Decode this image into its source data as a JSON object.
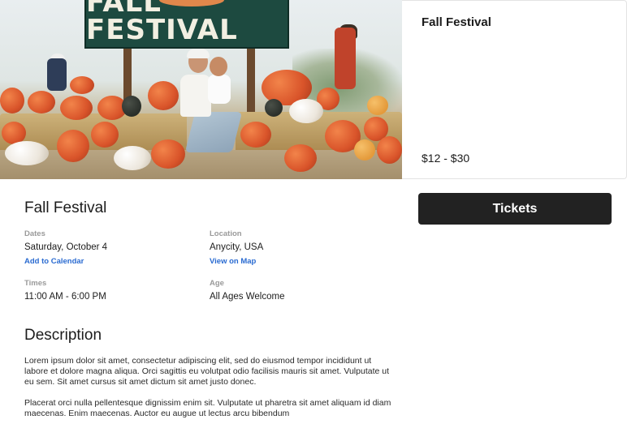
{
  "hero": {
    "sign_text": "FALL FESTIVAL"
  },
  "card": {
    "title": "Fall Festival",
    "price": "$12 - $30"
  },
  "event": {
    "title": "Fall Festival",
    "dates_label": "Dates",
    "dates_value": "Saturday, October 4",
    "add_to_calendar": "Add to Calendar",
    "location_label": "Location",
    "location_value": "Anycity, USA",
    "view_on_map": "View on Map",
    "times_label": "Times",
    "times_value": "11:00 AM - 6:00 PM",
    "age_label": "Age",
    "age_value": "All Ages Welcome"
  },
  "description": {
    "title": "Description",
    "paragraph_1": "Lorem ipsum dolor sit amet, consectetur adipiscing elit, sed do eiusmod tempor incididunt ut labore et dolore magna aliqua. Orci sagittis eu volutpat odio facilisis mauris sit amet. Vulputate ut eu sem. Sit amet cursus sit amet dictum sit amet justo donec.",
    "paragraph_2": "Placerat orci nulla pellentesque dignissim enim sit. Vulputate ut pharetra sit amet aliquam id diam maecenas. Enim maecenas. Auctor eu augue ut lectus arcu bibendum"
  },
  "tickets": {
    "label": "Tickets"
  },
  "colors": {
    "button_bg": "#222222",
    "link": "#2a6bd1",
    "muted_label": "#9a9a9a"
  }
}
